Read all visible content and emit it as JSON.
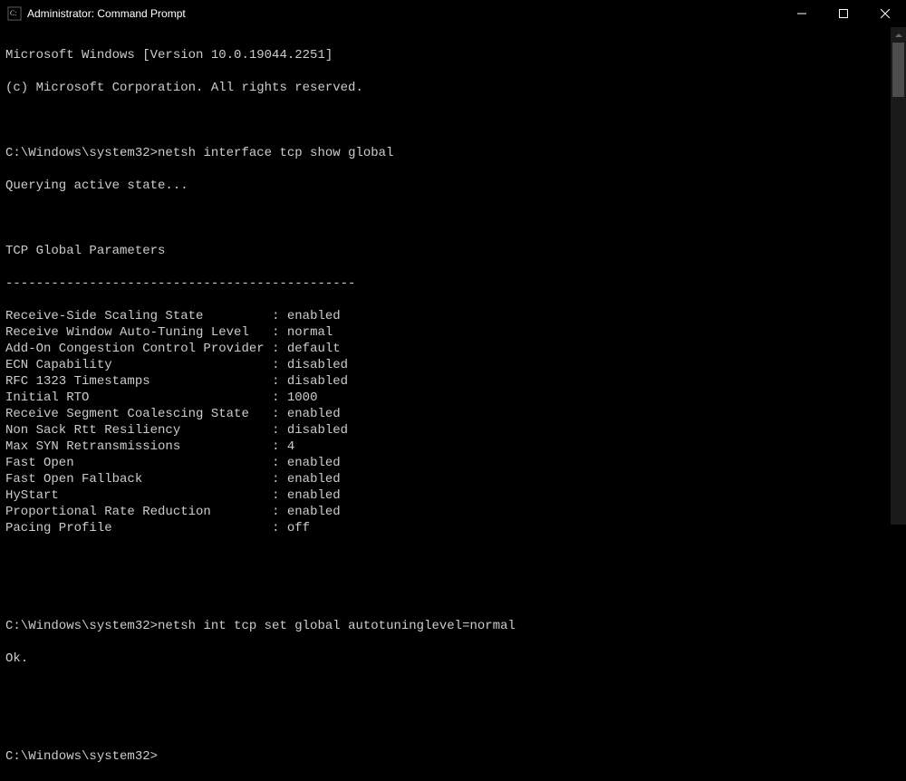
{
  "titlebar": {
    "title": "Administrator: Command Prompt"
  },
  "header": {
    "line1": "Microsoft Windows [Version 10.0.19044.2251]",
    "line2": "(c) Microsoft Corporation. All rights reserved."
  },
  "prompt1": "C:\\Windows\\system32>",
  "command1": "netsh interface tcp show global",
  "querying": "Querying active state...",
  "section_header": "TCP Global Parameters",
  "divider": "----------------------------------------------",
  "params": [
    {
      "label": "Receive-Side Scaling State",
      "value": "enabled"
    },
    {
      "label": "Receive Window Auto-Tuning Level",
      "value": "normal"
    },
    {
      "label": "Add-On Congestion Control Provider",
      "value": "default"
    },
    {
      "label": "ECN Capability",
      "value": "disabled"
    },
    {
      "label": "RFC 1323 Timestamps",
      "value": "disabled"
    },
    {
      "label": "Initial RTO",
      "value": "1000"
    },
    {
      "label": "Receive Segment Coalescing State",
      "value": "enabled"
    },
    {
      "label": "Non Sack Rtt Resiliency",
      "value": "disabled"
    },
    {
      "label": "Max SYN Retransmissions",
      "value": "4"
    },
    {
      "label": "Fast Open",
      "value": "enabled"
    },
    {
      "label": "Fast Open Fallback",
      "value": "enabled"
    },
    {
      "label": "HyStart",
      "value": "enabled"
    },
    {
      "label": "Proportional Rate Reduction",
      "value": "enabled"
    },
    {
      "label": "Pacing Profile",
      "value": "off"
    }
  ],
  "prompt2": "C:\\Windows\\system32>",
  "command2": "netsh int tcp set global autotuninglevel=normal",
  "result2": "Ok.",
  "prompt3": "C:\\Windows\\system32>"
}
